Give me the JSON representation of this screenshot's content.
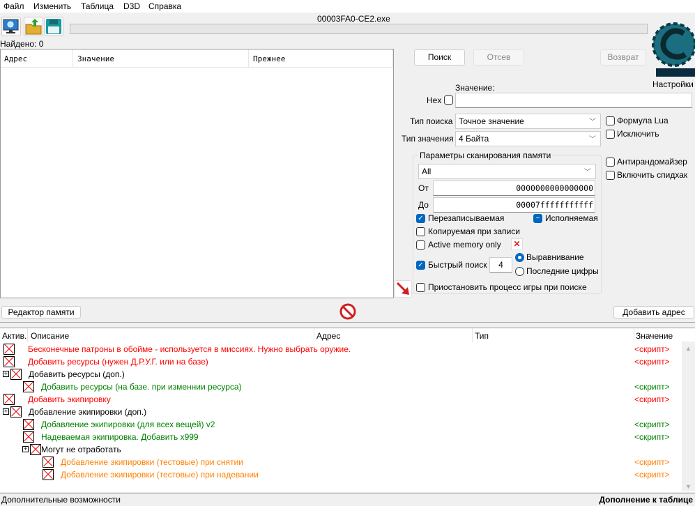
{
  "menu": [
    "Файл",
    "Изменить",
    "Таблица",
    "D3D",
    "Справка"
  ],
  "process_title": "00003FA0-CE2.exe",
  "found_label": "Найдено: 0",
  "results_columns": [
    "Адрес",
    "Значение",
    "Прежнее"
  ],
  "buttons": {
    "search": "Поиск",
    "filter": "Отсев",
    "undo": "Возврат",
    "memory_view": "Редактор памяти",
    "add_address": "Добавить адрес"
  },
  "logo_text": "Cheat Engine",
  "settings_label": "Настройки",
  "value_label": "Значение:",
  "hex_label": "Hex",
  "value_input": "",
  "scan_type_label": "Тип поиска",
  "scan_type": "Точное значение",
  "value_type_label": "Тип значения",
  "value_type": "4 Байта",
  "lua_formula": "Формула Lua",
  "not_label": "Исключить",
  "antirandom": "Антирандомайзер",
  "speedhack": "Включить спидхак",
  "mem_group": {
    "title": "Параметры сканирования памяти",
    "region": "All",
    "from_label": "От",
    "from": "0000000000000000",
    "to_label": "До",
    "to": "00007fffffffffff",
    "writable": "Перезаписываемая",
    "executable": "Исполняемая",
    "copy_on_write": "Копируемая при записи",
    "active_memory": "Active memory only",
    "fast_scan": "Быстрый поиск",
    "fast_scan_value": "4",
    "alignment": "Выравнивание",
    "last_digits": "Последние цифры",
    "pause": "Приостановить процесс игры при поиске"
  },
  "table_columns": [
    "Актив.",
    "Описание",
    "Адрес",
    "Тип",
    "Значение"
  ],
  "colors": {
    "red": "#ff0000",
    "green": "#008000",
    "orange": "#ff8000",
    "black": "#000000"
  },
  "entries": [
    {
      "desc": "Бесконечные патроны в обойме - используется в миссиях. Нужно выбрать оружие.",
      "value": "<скрипт>",
      "color": "red",
      "level": 0,
      "expand": false
    },
    {
      "desc": "Добавить ресурсы (нужен Д.Р.У.Г. или на базе)",
      "value": "<скрипт>",
      "color": "red",
      "level": 0,
      "expand": false
    },
    {
      "desc": "Добавить ресурсы (доп.)",
      "value": "",
      "color": "black",
      "level": 0,
      "expand": true
    },
    {
      "desc": "Добавить ресурсы (на базе. при изменнии ресурса)",
      "value": "<скрипт>",
      "color": "green",
      "level": 1,
      "expand": false
    },
    {
      "desc": "Добавить экипировку",
      "value": "<скрипт>",
      "color": "red",
      "level": 0,
      "expand": false
    },
    {
      "desc": "Добавление экипировки (доп.)",
      "value": "",
      "color": "black",
      "level": 0,
      "expand": true
    },
    {
      "desc": "Добавление экипировки (для всех вещей) v2",
      "value": "<скрипт>",
      "color": "green",
      "level": 1,
      "expand": false
    },
    {
      "desc": "Надеваемая экипировка. Добавить x999",
      "value": "<скрипт>",
      "color": "green",
      "level": 1,
      "expand": false
    },
    {
      "desc": "Могут не отработать",
      "value": "",
      "color": "black",
      "level": 1,
      "expand": true
    },
    {
      "desc": "Добавление экипировки (тестовые) при снятии",
      "value": "<скрипт>",
      "color": "orange",
      "level": 2,
      "expand": false
    },
    {
      "desc": "Добавление экипировки (тестовые) при надевании",
      "value": "<скрипт>",
      "color": "orange",
      "level": 2,
      "expand": false
    }
  ],
  "status_left": "Дополнительные возможности",
  "status_right": "Дополнение к таблице"
}
